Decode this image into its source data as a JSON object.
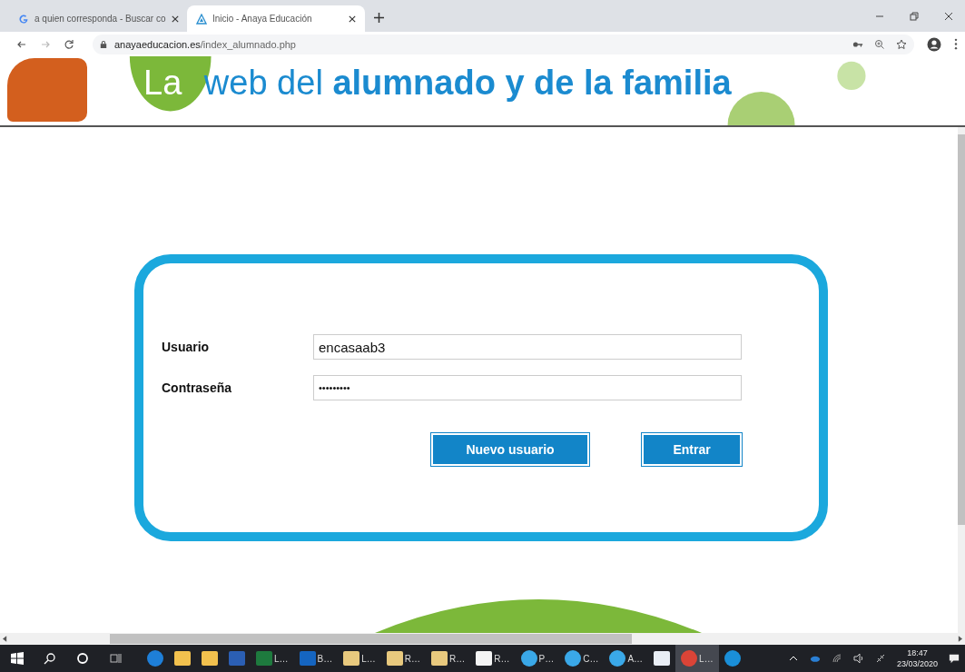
{
  "browser": {
    "tabs": [
      {
        "title": "a quien corresponda - Buscar co",
        "kind": "google",
        "selected": false
      },
      {
        "title": "Inicio - Anaya Educación",
        "kind": "anaya",
        "selected": true
      }
    ],
    "url_domain": "anayaeducacion.es",
    "url_path": "/index_alumnado.php"
  },
  "header": {
    "title_light": "La",
    "title_mid": "web del",
    "title_bold": "alumnado y de la familia"
  },
  "login": {
    "fields": [
      {
        "label": "Usuario",
        "value": "encasaab3",
        "kind": "text"
      },
      {
        "label": "Contraseña",
        "value": "•••••••••",
        "kind": "password"
      }
    ],
    "buttons": [
      "Nuevo usuario",
      "Entrar"
    ]
  },
  "taskbar": {
    "apps": [
      {
        "kind": "edge",
        "selected": false
      },
      {
        "kind": "folder",
        "selected": false
      },
      {
        "kind": "onedrive-folder",
        "selected": false
      },
      {
        "kind": "word",
        "selected": false
      },
      {
        "kind": "excel",
        "label": "L…",
        "selected": false
      },
      {
        "kind": "outlook",
        "label": "B…",
        "selected": false
      },
      {
        "kind": "mail",
        "label": "L…",
        "selected": false
      },
      {
        "kind": "mail",
        "label": "R…",
        "selected": false
      },
      {
        "kind": "mail",
        "label": "R…",
        "selected": false
      },
      {
        "kind": "mail-white",
        "label": "R…",
        "selected": false
      },
      {
        "kind": "ie",
        "label": "P…",
        "selected": false
      },
      {
        "kind": "ie",
        "label": "C…",
        "selected": false
      },
      {
        "kind": "ie",
        "label": "A…",
        "selected": false
      },
      {
        "kind": "java",
        "selected": false
      },
      {
        "kind": "chrome",
        "label": "L…",
        "selected": true
      },
      {
        "kind": "help",
        "selected": false
      }
    ],
    "time": "18:47",
    "date": "23/03/2020"
  }
}
